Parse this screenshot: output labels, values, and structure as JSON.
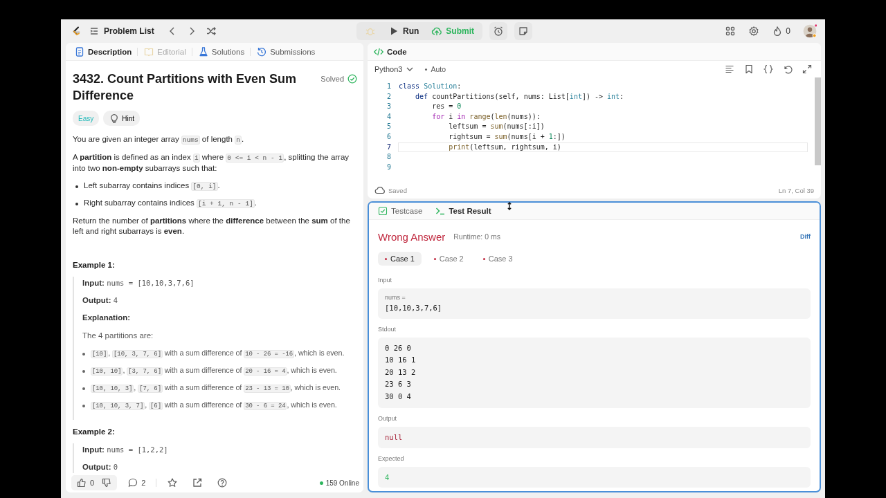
{
  "top_bar": {
    "problem_list": "Problem List",
    "run": "Run",
    "submit": "Submit",
    "streak": "0"
  },
  "left_tabs": [
    {
      "label": "Description",
      "selected": true,
      "disabled": false
    },
    {
      "label": "Editorial",
      "selected": false,
      "disabled": true
    },
    {
      "label": "Solutions",
      "selected": false,
      "disabled": false
    },
    {
      "label": "Submissions",
      "selected": false,
      "disabled": false
    }
  ],
  "problem": {
    "title": "3432. Count Partitions with Even Sum Difference",
    "status": "Solved",
    "difficulty": "Easy",
    "hint": "Hint",
    "content": [
      {
        "kind": "p",
        "parts": [
          {
            "kind": "text",
            "text": "You are given an integer array "
          },
          {
            "kind": "code",
            "text": "nums"
          },
          {
            "kind": "text",
            "text": " of length "
          },
          {
            "kind": "code",
            "text": "n"
          },
          {
            "kind": "text",
            "text": "."
          }
        ]
      },
      {
        "kind": "p",
        "parts": [
          {
            "kind": "text",
            "text": "A **partition** is defined as an index "
          },
          {
            "kind": "code",
            "text": "i"
          },
          {
            "kind": "text",
            "text": " where "
          },
          {
            "kind": "code",
            "text": "0 <= i < n - 1"
          },
          {
            "kind": "text",
            "text": ", splitting the array into two **non-empty** subarrays such that:"
          }
        ]
      },
      {
        "kind": "ul",
        "items": [
          [
            {
              "kind": "text",
              "text": "Left subarray contains indices "
            },
            {
              "kind": "code",
              "text": "[0, i]"
            },
            {
              "kind": "text",
              "text": "."
            }
          ],
          [
            {
              "kind": "text",
              "text": "Right subarray contains indices "
            },
            {
              "kind": "code",
              "text": "[i + 1, n - 1]"
            },
            {
              "kind": "text",
              "text": "."
            }
          ]
        ]
      },
      {
        "kind": "p",
        "parts": [
          {
            "kind": "text",
            "text": "Return the number of **partitions** where the **difference** between the **sum** of the left and right subarrays is **even**."
          }
        ]
      },
      {
        "kind": "heading",
        "text": "Example 1:"
      },
      {
        "kind": "example",
        "blocks": [
          {
            "kind": "p",
            "parts": [
              {
                "kind": "text",
                "text": "**Input:** "
              },
              {
                "kind": "mono",
                "text": "nums = [10,10,3,7,6]"
              }
            ]
          },
          {
            "kind": "p",
            "parts": [
              {
                "kind": "text",
                "text": "**Output:** "
              },
              {
                "kind": "mono",
                "text": "4"
              }
            ]
          },
          {
            "kind": "label",
            "text": "Explanation:"
          },
          {
            "kind": "p",
            "parts": [
              {
                "kind": "text",
                "text": "The 4 partitions are:"
              }
            ]
          },
          {
            "kind": "ul",
            "items": [
              [
                {
                  "kind": "code",
                  "text": "[10]"
                },
                {
                  "kind": "text",
                  "text": ", "
                },
                {
                  "kind": "code",
                  "text": "[10, 3, 7, 6]"
                },
                {
                  "kind": "text",
                  "text": " with a sum difference of "
                },
                {
                  "kind": "code",
                  "text": "10 - 26 = -16"
                },
                {
                  "kind": "text",
                  "text": ", which is even."
                }
              ],
              [
                {
                  "kind": "code",
                  "text": "[10, 10]"
                },
                {
                  "kind": "text",
                  "text": ", "
                },
                {
                  "kind": "code",
                  "text": "[3, 7, 6]"
                },
                {
                  "kind": "text",
                  "text": " with a sum difference of "
                },
                {
                  "kind": "code",
                  "text": "20 - 16 = 4"
                },
                {
                  "kind": "text",
                  "text": ", which is even."
                }
              ],
              [
                {
                  "kind": "code",
                  "text": "[10, 10, 3]"
                },
                {
                  "kind": "text",
                  "text": ", "
                },
                {
                  "kind": "code",
                  "text": "[7, 6]"
                },
                {
                  "kind": "text",
                  "text": " with a sum difference of "
                },
                {
                  "kind": "code",
                  "text": "23 - 13 = 10"
                },
                {
                  "kind": "text",
                  "text": ", which is even."
                }
              ],
              [
                {
                  "kind": "code",
                  "text": "[10, 10, 3, 7]"
                },
                {
                  "kind": "text",
                  "text": ", "
                },
                {
                  "kind": "code",
                  "text": "[6]"
                },
                {
                  "kind": "text",
                  "text": " with a sum difference of "
                },
                {
                  "kind": "code",
                  "text": "30 - 6 = 24"
                },
                {
                  "kind": "text",
                  "text": ", which is even."
                }
              ]
            ]
          }
        ]
      },
      {
        "kind": "heading",
        "text": "Example 2:"
      },
      {
        "kind": "example",
        "blocks": [
          {
            "kind": "p",
            "parts": [
              {
                "kind": "text",
                "text": "**Input:** "
              },
              {
                "kind": "mono",
                "text": "nums = [1,2,2]"
              }
            ]
          },
          {
            "kind": "p",
            "parts": [
              {
                "kind": "text",
                "text": "**Output:** "
              },
              {
                "kind": "mono",
                "text": "0"
              }
            ]
          }
        ]
      }
    ]
  },
  "bottom_bar": {
    "likes": "0",
    "comments": "2",
    "online": "159 Online"
  },
  "code_panel": {
    "title": "Code",
    "language": "Python3",
    "mode": "Auto",
    "saved": "Saved",
    "cursor": "Ln 7, Col 39",
    "lines": [
      {
        "number": "1",
        "current": false,
        "tokens": [
          {
            "kind": "kw",
            "text": "class"
          },
          {
            "kind": "type",
            "text": " Solution"
          },
          {
            "kind": "plain",
            "text": ":"
          }
        ]
      },
      {
        "number": "2",
        "current": false,
        "tokens": [
          {
            "kind": "kw",
            "text": "    def"
          },
          {
            "kind": "plain",
            "text": " countPartitions(self, nums: List["
          },
          {
            "kind": "type",
            "text": "int"
          },
          {
            "kind": "plain",
            "text": "]) -> "
          },
          {
            "kind": "type",
            "text": "int"
          },
          {
            "kind": "plain",
            "text": ":"
          }
        ]
      },
      {
        "number": "3",
        "current": false,
        "tokens": [
          {
            "kind": "plain",
            "text": "        res = "
          },
          {
            "kind": "num",
            "text": "0"
          }
        ]
      },
      {
        "number": "4",
        "current": false,
        "tokens": [
          {
            "kind": "ctl",
            "text": "        for"
          },
          {
            "kind": "plain",
            "text": " i "
          },
          {
            "kind": "ctl",
            "text": "in"
          },
          {
            "kind": "builtin",
            "text": " range"
          },
          {
            "kind": "plain",
            "text": "("
          },
          {
            "kind": "builtin",
            "text": "len"
          },
          {
            "kind": "plain",
            "text": "(nums)):"
          }
        ]
      },
      {
        "number": "5",
        "current": false,
        "tokens": [
          {
            "kind": "plain",
            "text": "            leftsum = "
          },
          {
            "kind": "builtin",
            "text": "sum"
          },
          {
            "kind": "plain",
            "text": "(nums[:i])"
          }
        ]
      },
      {
        "number": "6",
        "current": false,
        "tokens": [
          {
            "kind": "plain",
            "text": "            rightsum = "
          },
          {
            "kind": "builtin",
            "text": "sum"
          },
          {
            "kind": "plain",
            "text": "(nums[i + "
          },
          {
            "kind": "num",
            "text": "1"
          },
          {
            "kind": "plain",
            "text": ":])"
          }
        ]
      },
      {
        "number": "7",
        "current": true,
        "tokens": [
          {
            "kind": "builtin",
            "text": "            print"
          },
          {
            "kind": "plain",
            "text": "(leftsum, rightsum, i)"
          }
        ]
      },
      {
        "number": "8",
        "current": false
      },
      {
        "number": "9",
        "current": false
      }
    ]
  },
  "test_tabs": [
    {
      "label": "Testcase",
      "selected": false
    },
    {
      "label": "Test Result",
      "selected": true
    }
  ],
  "result": {
    "verdict": "Wrong Answer",
    "runtime": "Runtime: 0 ms",
    "diff": "Diff",
    "cases": [
      {
        "label": "Case 1",
        "selected": true,
        "passed": false
      },
      {
        "label": "Case 2",
        "selected": false,
        "passed": false
      },
      {
        "label": "Case 3",
        "selected": false,
        "passed": false
      }
    ],
    "sections": [
      {
        "label": "Input",
        "kind": "input",
        "name": "nums =",
        "value": "[10,10,3,7,6]"
      },
      {
        "label": "Stdout",
        "kind": "stdout",
        "lines": [
          "0 26 0",
          "10 16 1",
          "20 13 2",
          "23 6 3",
          "30 0 4"
        ]
      },
      {
        "label": "Output",
        "kind": "output",
        "value": "null"
      },
      {
        "label": "Expected",
        "kind": "expected",
        "value": "4"
      }
    ]
  }
}
